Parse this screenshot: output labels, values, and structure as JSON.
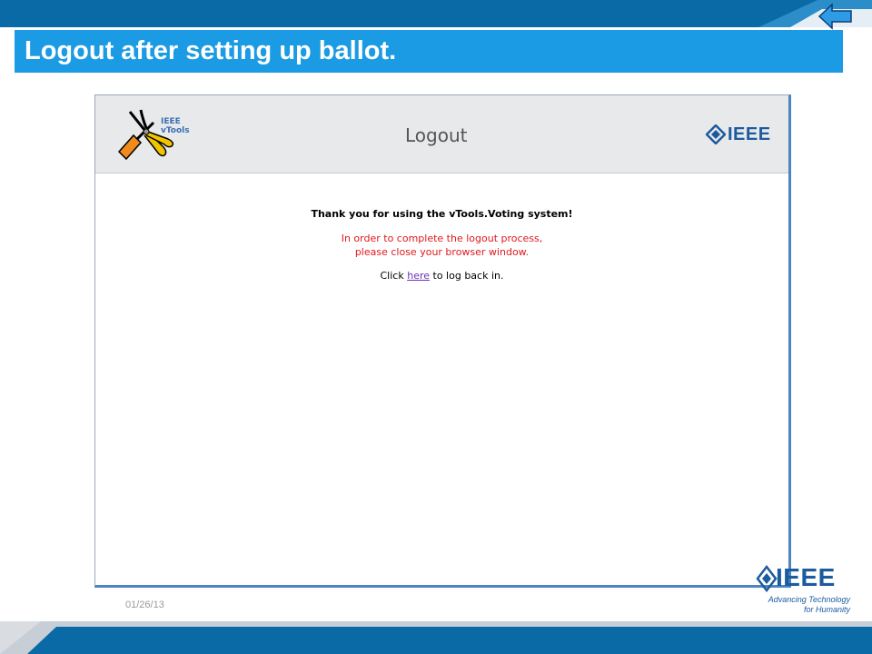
{
  "slide": {
    "title": "Logout after setting up ballot.",
    "date": "01/26/13",
    "footer_logo": {
      "name": "IEEE",
      "tagline_line1": "Advancing Technology",
      "tagline_line2": "for Humanity"
    },
    "colors": {
      "top_band": "#0a6aa6",
      "title_bar": "#1a9be3",
      "bottom_band": "#0a6aa6",
      "accent_blue": "#1b5b9e"
    }
  },
  "app": {
    "logo_line1": "IEEE",
    "logo_line2": "vTools",
    "page_heading": "Logout",
    "brand": "IEEE",
    "message_bold": "Thank you for using the vTools.Voting system!",
    "message_red_line1": "In order to complete the logout process,",
    "message_red_line2": "please close your browser window.",
    "click_prefix": "Click ",
    "click_link": "here",
    "click_suffix": " to log back in.",
    "colors": {
      "warning_text": "#e0191e",
      "link": "#6a2fb3",
      "header_bg": "#e8e9eb"
    }
  },
  "icons": {
    "back": "back-arrow-icon",
    "tools": "tools-icon",
    "ieee_diamond": "ieee-diamond-icon"
  }
}
